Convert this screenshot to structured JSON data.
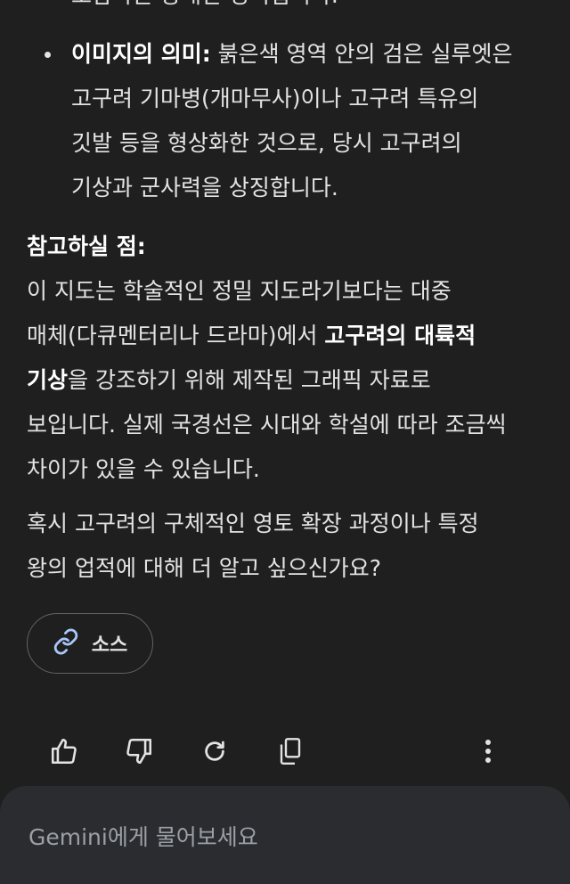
{
  "response": {
    "cut_line": "포함하는 광대한 영역입니다.",
    "bullet": {
      "label": "이미지의 의미:",
      "lines": [
        "붉은색 영역 안의 검은 실루엣은",
        "고구려 기마병(개마무사)이나 고구려 특유의",
        "깃발 등을 형상화한 것으로, 당시 고구려의",
        "기상과 군사력을 상징합니다."
      ]
    },
    "note": {
      "heading": "참고하실 점:",
      "line1": "이 지도는 학술적인 정밀 지도라기보다는 대중",
      "line2_a": "매체(다큐멘터리나 드라마)에서 ",
      "line2_b": "고구려의 대륙적",
      "line3_a": "기상",
      "line3_b": "을 강조하기 위해 제작된 그래픽 자료로",
      "line4": "보입니다. 실제 국경선은 시대와 학설에 따라 조금씩",
      "line5": "차이가 있을 수 있습니다."
    },
    "question": {
      "line1": "혹시 고구려의 구체적인 영토 확장 과정이나 특정",
      "line2": "왕의 업적에 대해 더 알고 싶으신가요?"
    }
  },
  "sources_chip": {
    "label": "소스",
    "icon": "link-icon"
  },
  "actions": [
    {
      "name": "thumbs-up",
      "icon": "thumbs-up-icon"
    },
    {
      "name": "thumbs-down",
      "icon": "thumbs-down-icon"
    },
    {
      "name": "regenerate",
      "icon": "refresh-icon"
    },
    {
      "name": "copy",
      "icon": "copy-icon"
    },
    {
      "name": "more",
      "icon": "more-vertical-icon"
    }
  ],
  "input": {
    "placeholder": "Gemini에게 물어보세요"
  },
  "colors": {
    "background": "#1f1f1f",
    "text": "#e3e3e3",
    "accent": "#a8c7fa",
    "input_bar": "#2b2c2f"
  }
}
